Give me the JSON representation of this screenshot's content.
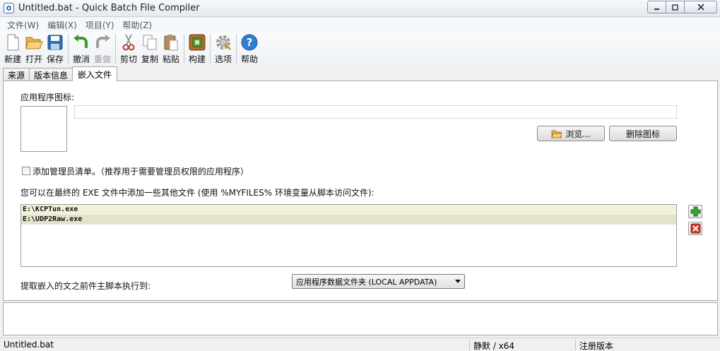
{
  "window": {
    "title": "Untitled.bat - Quick Batch File Compiler"
  },
  "menu": [
    "文件(W)",
    "编辑(X)",
    "项目(Y)",
    "帮助(Z)"
  ],
  "toolbar": {
    "new": "新建",
    "open": "打开",
    "save": "保存",
    "undo": "撤消",
    "redo": "重做",
    "cut": "剪切",
    "copy": "复制",
    "paste": "粘贴",
    "build": "构建",
    "options": "选项",
    "help": "帮助"
  },
  "tabs": [
    "来源",
    "版本信息",
    "嵌入文件"
  ],
  "embed": {
    "app_icon_label": "应用程序图标:",
    "icon_path_value": "",
    "browse_label": "浏览...",
    "delete_icon_label": "删除图标",
    "admin_manifest_label": "添加管理员清单。（推荐用于需要管理员权限的应用程序）",
    "admin_manifest_checked": false,
    "files_hint": "您可以在最终的 EXE 文件中添加一些其他文件 (使用 %MYFILES% 环境变量从脚本访问文件):",
    "files": [
      "E:\\KCPTun.exe",
      "E:\\UDP2Raw.exe"
    ],
    "extract_label": "提取嵌入的文之前件主脚本执行到:",
    "extract_target": "应用程序数据文件夹 (LOCAL APPDATA)"
  },
  "status": {
    "file": "Untitled.bat",
    "mode": "静默 / x64",
    "license": "注册版本"
  }
}
